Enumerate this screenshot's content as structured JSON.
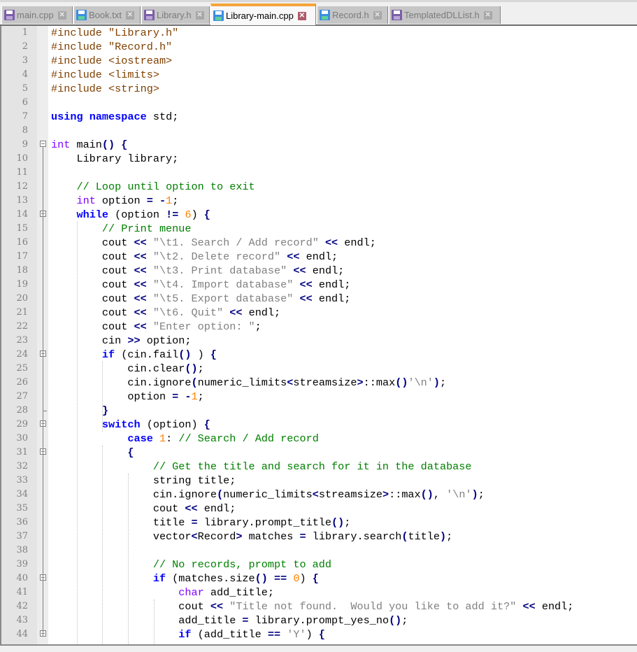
{
  "tabs": [
    {
      "label": "main.cpp",
      "icon": "floppy-disk-purple",
      "active": false
    },
    {
      "label": "Book.txt",
      "icon": "floppy-disk-blue",
      "active": false
    },
    {
      "label": "Library.h",
      "icon": "floppy-disk-purple",
      "active": false
    },
    {
      "label": "Library-main.cpp",
      "icon": "floppy-disk-blue",
      "active": true
    },
    {
      "label": "Record.h",
      "icon": "floppy-disk-blue",
      "active": false
    },
    {
      "label": "TemplatedDLList.h",
      "icon": "floppy-disk-purple",
      "active": false
    }
  ],
  "editor": {
    "lines": [
      {
        "n": "1",
        "fold": "none",
        "tokens": [
          [
            "pp",
            "#include \"Library.h\""
          ]
        ]
      },
      {
        "n": "2",
        "fold": "none",
        "tokens": [
          [
            "pp",
            "#include \"Record.h\""
          ]
        ]
      },
      {
        "n": "3",
        "fold": "none",
        "tokens": [
          [
            "pp",
            "#include <iostream>"
          ]
        ]
      },
      {
        "n": "4",
        "fold": "none",
        "tokens": [
          [
            "pp",
            "#include <limits>"
          ]
        ]
      },
      {
        "n": "5",
        "fold": "none",
        "tokens": [
          [
            "pp",
            "#include <string>"
          ]
        ]
      },
      {
        "n": "6",
        "fold": "none",
        "tokens": []
      },
      {
        "n": "7",
        "fold": "none",
        "tokens": [
          [
            "kw",
            "using"
          ],
          [
            "",
            ""
          ],
          [
            "",
            " "
          ],
          [
            "kw",
            "namespace"
          ],
          [
            "",
            " std;"
          ]
        ]
      },
      {
        "n": "8",
        "fold": "none",
        "tokens": []
      },
      {
        "n": "9",
        "fold": "open",
        "tokens": [
          [
            "ty",
            "int"
          ],
          [
            "",
            " main"
          ],
          [
            "op",
            "()"
          ],
          [
            "",
            " "
          ],
          [
            "op",
            "{"
          ]
        ]
      },
      {
        "n": "10",
        "fold": "none",
        "tokens": [
          [
            "",
            "    Library library;"
          ]
        ]
      },
      {
        "n": "11",
        "fold": "none",
        "tokens": []
      },
      {
        "n": "12",
        "fold": "none",
        "tokens": [
          [
            "",
            "    "
          ],
          [
            "cm",
            "// Loop until option to exit"
          ]
        ]
      },
      {
        "n": "13",
        "fold": "none",
        "tokens": [
          [
            "",
            "    "
          ],
          [
            "ty",
            "int"
          ],
          [
            "",
            " option "
          ],
          [
            "op",
            "="
          ],
          [
            "",
            " "
          ],
          [
            "op",
            "-"
          ],
          [
            "nu",
            "1"
          ],
          [
            "",
            ";"
          ]
        ]
      },
      {
        "n": "14",
        "fold": "open",
        "tokens": [
          [
            "",
            "    "
          ],
          [
            "kw",
            "while"
          ],
          [
            "",
            " (option "
          ],
          [
            "op",
            "!="
          ],
          [
            "",
            " "
          ],
          [
            "nu",
            "6"
          ],
          [
            "",
            ") "
          ],
          [
            "op",
            "{"
          ]
        ]
      },
      {
        "n": "15",
        "fold": "none",
        "tokens": [
          [
            "",
            "        "
          ],
          [
            "cm",
            "// Print menue"
          ]
        ]
      },
      {
        "n": "16",
        "fold": "none",
        "tokens": [
          [
            "",
            "        cout "
          ],
          [
            "op",
            "<<"
          ],
          [
            "",
            " "
          ],
          [
            "st",
            "\"\\t1. Search / Add record\""
          ],
          [
            "",
            " "
          ],
          [
            "op",
            "<<"
          ],
          [
            "",
            " endl;"
          ]
        ]
      },
      {
        "n": "17",
        "fold": "none",
        "tokens": [
          [
            "",
            "        cout "
          ],
          [
            "op",
            "<<"
          ],
          [
            "",
            " "
          ],
          [
            "st",
            "\"\\t2. Delete record\""
          ],
          [
            "",
            " "
          ],
          [
            "op",
            "<<"
          ],
          [
            "",
            " endl;"
          ]
        ]
      },
      {
        "n": "18",
        "fold": "none",
        "tokens": [
          [
            "",
            "        cout "
          ],
          [
            "op",
            "<<"
          ],
          [
            "",
            " "
          ],
          [
            "st",
            "\"\\t3. Print database\""
          ],
          [
            "",
            " "
          ],
          [
            "op",
            "<<"
          ],
          [
            "",
            " endl;"
          ]
        ]
      },
      {
        "n": "19",
        "fold": "none",
        "tokens": [
          [
            "",
            "        cout "
          ],
          [
            "op",
            "<<"
          ],
          [
            "",
            " "
          ],
          [
            "st",
            "\"\\t4. Import database\""
          ],
          [
            "",
            " "
          ],
          [
            "op",
            "<<"
          ],
          [
            "",
            " endl;"
          ]
        ]
      },
      {
        "n": "20",
        "fold": "none",
        "tokens": [
          [
            "",
            "        cout "
          ],
          [
            "op",
            "<<"
          ],
          [
            "",
            " "
          ],
          [
            "st",
            "\"\\t5. Export database\""
          ],
          [
            "",
            " "
          ],
          [
            "op",
            "<<"
          ],
          [
            "",
            " endl;"
          ]
        ]
      },
      {
        "n": "21",
        "fold": "none",
        "tokens": [
          [
            "",
            "        cout "
          ],
          [
            "op",
            "<<"
          ],
          [
            "",
            " "
          ],
          [
            "st",
            "\"\\t6. Quit\""
          ],
          [
            "",
            " "
          ],
          [
            "op",
            "<<"
          ],
          [
            "",
            " endl;"
          ]
        ]
      },
      {
        "n": "22",
        "fold": "none",
        "tokens": [
          [
            "",
            "        cout "
          ],
          [
            "op",
            "<<"
          ],
          [
            "",
            " "
          ],
          [
            "st",
            "\"Enter option: \""
          ],
          [
            "",
            ";"
          ]
        ]
      },
      {
        "n": "23",
        "fold": "none",
        "tokens": [
          [
            "",
            "        cin "
          ],
          [
            "op",
            ">>"
          ],
          [
            "",
            " option;"
          ]
        ]
      },
      {
        "n": "24",
        "fold": "open",
        "tokens": [
          [
            "",
            "        "
          ],
          [
            "kw",
            "if"
          ],
          [
            "",
            " (cin.fail"
          ],
          [
            "op",
            "()"
          ],
          [
            "",
            " ) "
          ],
          [
            "op",
            "{"
          ]
        ]
      },
      {
        "n": "25",
        "fold": "none",
        "tokens": [
          [
            "",
            "            cin.clear"
          ],
          [
            "op",
            "()"
          ],
          [
            "",
            ";"
          ]
        ]
      },
      {
        "n": "26",
        "fold": "none",
        "tokens": [
          [
            "",
            "            cin.ignore"
          ],
          [
            "op",
            "("
          ],
          [
            "",
            "numeric_limits"
          ],
          [
            "op",
            "<"
          ],
          [
            "",
            "streamsize"
          ],
          [
            "op",
            ">"
          ],
          [
            "",
            "::max"
          ],
          [
            "op",
            "()"
          ],
          [
            ", "
          ],
          [
            "st",
            "'\\n'"
          ],
          [
            "op",
            ")"
          ],
          [
            "",
            ";"
          ]
        ]
      },
      {
        "n": "27",
        "fold": "none",
        "tokens": [
          [
            "",
            "            option "
          ],
          [
            "op",
            "="
          ],
          [
            "",
            " "
          ],
          [
            "op",
            "-"
          ],
          [
            "nu",
            "1"
          ],
          [
            "",
            ";"
          ]
        ]
      },
      {
        "n": "28",
        "fold": "end",
        "tokens": [
          [
            "",
            "        "
          ],
          [
            "op",
            "}"
          ]
        ]
      },
      {
        "n": "29",
        "fold": "open",
        "tokens": [
          [
            "",
            "        "
          ],
          [
            "kw",
            "switch"
          ],
          [
            "",
            " (option) "
          ],
          [
            "op",
            "{"
          ]
        ]
      },
      {
        "n": "30",
        "fold": "none",
        "tokens": [
          [
            "",
            "            "
          ],
          [
            "kw",
            "case"
          ],
          [
            "",
            " "
          ],
          [
            "nu",
            "1"
          ],
          [
            "",
            ": "
          ],
          [
            "cm",
            "// Search / Add record"
          ]
        ]
      },
      {
        "n": "31",
        "fold": "open",
        "tokens": [
          [
            "",
            "            "
          ],
          [
            "op",
            "{"
          ]
        ]
      },
      {
        "n": "32",
        "fold": "none",
        "tokens": [
          [
            "",
            "                "
          ],
          [
            "cm",
            "// Get the title and search for it in the database"
          ]
        ]
      },
      {
        "n": "33",
        "fold": "none",
        "tokens": [
          [
            "",
            "                string title;"
          ]
        ]
      },
      {
        "n": "34",
        "fold": "none",
        "tokens": [
          [
            "",
            "                cin.ignore"
          ],
          [
            "op",
            "("
          ],
          [
            "",
            "numeric_limits"
          ],
          [
            "op",
            "<"
          ],
          [
            "",
            "streamsize"
          ],
          [
            "op",
            ">"
          ],
          [
            "",
            "::max"
          ],
          [
            "op",
            "()"
          ],
          [
            "",
            ", "
          ],
          [
            "st",
            "'\\n'"
          ],
          [
            "op",
            ")"
          ],
          [
            "",
            ";"
          ]
        ]
      },
      {
        "n": "35",
        "fold": "none",
        "tokens": [
          [
            "",
            "                cout "
          ],
          [
            "op",
            "<<"
          ],
          [
            "",
            " endl;"
          ]
        ]
      },
      {
        "n": "36",
        "fold": "none",
        "tokens": [
          [
            "",
            "                title "
          ],
          [
            "op",
            "="
          ],
          [
            "",
            " library.prompt_title"
          ],
          [
            "op",
            "()"
          ],
          [
            "",
            ";"
          ]
        ]
      },
      {
        "n": "37",
        "fold": "none",
        "tokens": [
          [
            "",
            "                vector"
          ],
          [
            "op",
            "<"
          ],
          [
            "",
            "Record"
          ],
          [
            "op",
            ">"
          ],
          [
            "",
            " matches "
          ],
          [
            "op",
            "="
          ],
          [
            "",
            " library.search"
          ],
          [
            "op",
            "("
          ],
          [
            "",
            "title"
          ],
          [
            "op",
            ")"
          ],
          [
            "",
            ";"
          ]
        ]
      },
      {
        "n": "38",
        "fold": "none",
        "tokens": []
      },
      {
        "n": "39",
        "fold": "none",
        "tokens": [
          [
            "",
            "                "
          ],
          [
            "cm",
            "// No records, prompt to add"
          ]
        ]
      },
      {
        "n": "40",
        "fold": "open",
        "tokens": [
          [
            "",
            "                "
          ],
          [
            "kw",
            "if"
          ],
          [
            "",
            " (matches.size"
          ],
          [
            "op",
            "()"
          ],
          [
            "",
            " "
          ],
          [
            "op",
            "=="
          ],
          [
            "",
            " "
          ],
          [
            "nu",
            "0"
          ],
          [
            "",
            ") "
          ],
          [
            "op",
            "{"
          ]
        ]
      },
      {
        "n": "41",
        "fold": "none",
        "tokens": [
          [
            "",
            "                    "
          ],
          [
            "ty",
            "char"
          ],
          [
            "",
            " add_title;"
          ]
        ]
      },
      {
        "n": "42",
        "fold": "none",
        "tokens": [
          [
            "",
            "                    cout "
          ],
          [
            "op",
            "<<"
          ],
          [
            "",
            " "
          ],
          [
            "st",
            "\"Title not found.  Would you like to add it?\""
          ],
          [
            "",
            " "
          ],
          [
            "op",
            "<<"
          ],
          [
            "",
            " endl;"
          ]
        ]
      },
      {
        "n": "43",
        "fold": "none",
        "tokens": [
          [
            "",
            "                    add_title "
          ],
          [
            "op",
            "="
          ],
          [
            "",
            " library.prompt_yes_no"
          ],
          [
            "op",
            "()"
          ],
          [
            "",
            ";"
          ]
        ]
      },
      {
        "n": "44",
        "fold": "open",
        "tokens": [
          [
            "",
            "                    "
          ],
          [
            "kw",
            "if"
          ],
          [
            "",
            " (add_title "
          ],
          [
            "op",
            "=="
          ],
          [
            "",
            " "
          ],
          [
            "st",
            "'Y'"
          ],
          [
            "",
            ") "
          ],
          [
            "op",
            "{"
          ]
        ]
      }
    ]
  }
}
